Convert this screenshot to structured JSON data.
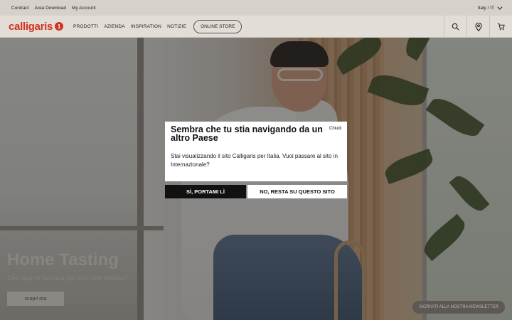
{
  "topbar": {
    "links": [
      "Contract",
      "Area Download",
      "My Account"
    ],
    "language": "Italy / IT"
  },
  "nav": {
    "logo_text": "calligaris",
    "logo_mark": "1",
    "items": [
      "PRODOTTI",
      "AZIENDA",
      "INSPIRATION",
      "NOTIZIE"
    ],
    "store_label": "ONLINE STORE",
    "icons": [
      "search-icon",
      "location-pin-icon",
      "cart-icon"
    ]
  },
  "hero": {
    "title": "Home Tasting",
    "subtitle": "Che sapore ha casa per uno chef stellato?",
    "cta": "scopri ora"
  },
  "newsletter": "ISCRIVITI ALLA NOSTRA NEWSLETTER",
  "modal": {
    "title": "Sembra che tu stia navigando da un altro Paese",
    "close": "Chiudi",
    "text": "Stai visualizzando il sito Calligaris per Italia. Vuoi passare al sito in Internazionale?",
    "yes_label": "SÌ, PORTAMI LÌ",
    "no_label": "NO, RESTA SU QUESTO SITO"
  },
  "colors": {
    "brand": "#d1321f",
    "overlay": "rgba(0,0,0,0.42)"
  }
}
